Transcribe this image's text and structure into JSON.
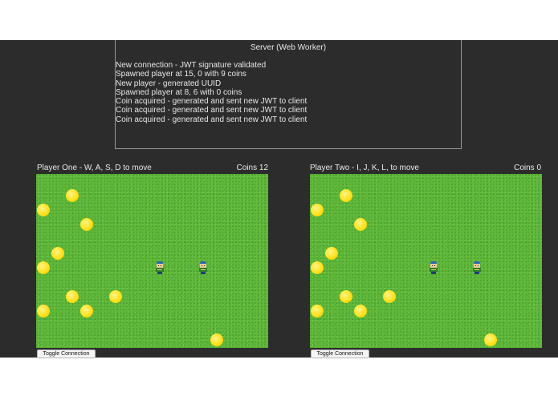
{
  "server": {
    "title": "Server (Web Worker)",
    "log": [
      "New connection - JWT signature validated",
      "Spawned player at 15, 0 with 9 coins",
      "New player - generated UUID",
      "Spawned player at 8, 6 with 0 coins",
      "Coin acquired - generated and sent new JWT to client",
      "Coin acquired - generated and sent new JWT to client",
      "Coin acquired - generated and sent new JWT to client"
    ]
  },
  "players": [
    {
      "label": "Player One - W, A, S, D to move",
      "coins_label": "Coins 12",
      "toggle_label": "Toggle Connection",
      "coin_icon": "coin-icon",
      "character_icon": "character-icon"
    },
    {
      "label": "Player Two - I, J, K, L, to move",
      "coins_label": "Coins 0",
      "toggle_label": "Toggle Connection",
      "coin_icon": "coin-icon",
      "character_icon": "character-icon"
    }
  ],
  "colors": {
    "background": "#2c2c2c",
    "grass": "#5fb83a",
    "coin": "#ffe52e",
    "text": "#eaeaea"
  }
}
